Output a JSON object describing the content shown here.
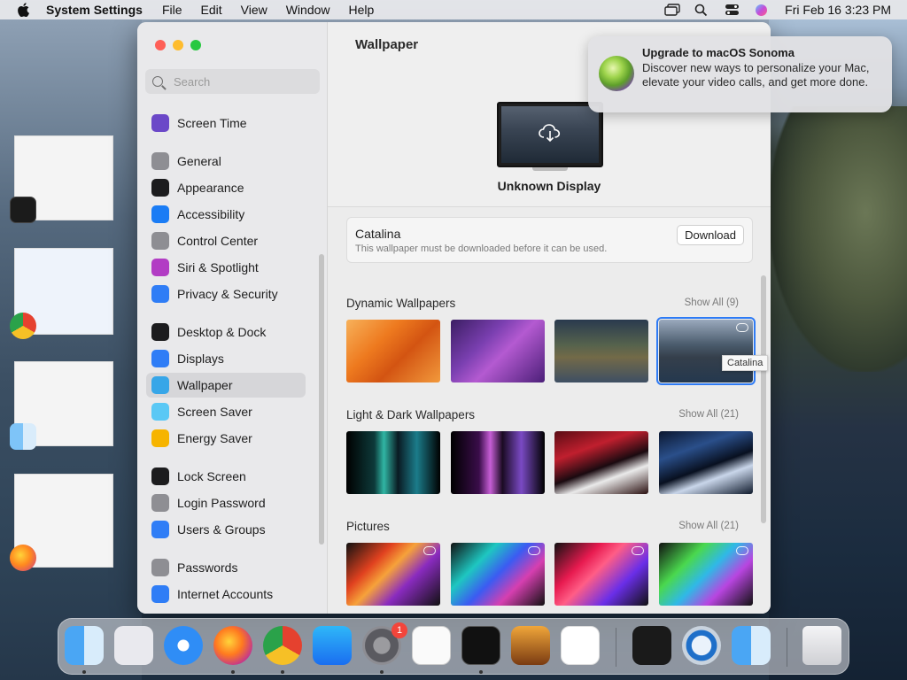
{
  "menubar": {
    "app_name": "System Settings",
    "items": [
      "File",
      "Edit",
      "View",
      "Window",
      "Help"
    ],
    "datetime": "Fri Feb 16  3:23 PM"
  },
  "window": {
    "search_placeholder": "Search",
    "sidebar": [
      {
        "label": "Screen Time",
        "icon": "hourglass-icon",
        "color": "#6b48c8"
      },
      {
        "label": "General",
        "icon": "gear-icon",
        "color": "#8e8e93"
      },
      {
        "label": "Appearance",
        "icon": "appearance-icon",
        "color": "#1c1c1e"
      },
      {
        "label": "Accessibility",
        "icon": "accessibility-icon",
        "color": "#1a7cf5"
      },
      {
        "label": "Control Center",
        "icon": "control-center-icon",
        "color": "#8e8e93"
      },
      {
        "label": "Siri & Spotlight",
        "icon": "siri-icon",
        "color": "#b23cc4"
      },
      {
        "label": "Privacy & Security",
        "icon": "hand-icon",
        "color": "#2f7df6"
      },
      {
        "label": "Desktop & Dock",
        "icon": "desktop-icon",
        "color": "#1c1c1e"
      },
      {
        "label": "Displays",
        "icon": "sun-icon",
        "color": "#2f7df6"
      },
      {
        "label": "Wallpaper",
        "icon": "flower-icon",
        "color": "#37a6e8",
        "active": true
      },
      {
        "label": "Screen Saver",
        "icon": "screen-saver-icon",
        "color": "#5ac8f5"
      },
      {
        "label": "Energy Saver",
        "icon": "battery-icon",
        "color": "#f6b400"
      },
      {
        "label": "Lock Screen",
        "icon": "lock-icon",
        "color": "#1c1c1e"
      },
      {
        "label": "Login Password",
        "icon": "lock-icon",
        "color": "#8e8e93"
      },
      {
        "label": "Users & Groups",
        "icon": "users-icon",
        "color": "#2f7df6"
      },
      {
        "label": "Passwords",
        "icon": "key-icon",
        "color": "#8e8e93"
      },
      {
        "label": "Internet Accounts",
        "icon": "at-icon",
        "color": "#2f7df6"
      }
    ],
    "title": "Wallpaper",
    "display_name": "Unknown Display",
    "current": {
      "name": "Catalina",
      "description": "This wallpaper must be downloaded before it can be used.",
      "download_label": "Download"
    },
    "sections": [
      {
        "title": "Dynamic Wallpapers",
        "show_all": "Show All (9)"
      },
      {
        "title": "Light & Dark Wallpapers",
        "show_all": "Show All (21)"
      },
      {
        "title": "Pictures",
        "show_all": "Show All (21)"
      }
    ],
    "tooltip": "Catalina"
  },
  "notification": {
    "title": "Upgrade to macOS Sonoma",
    "body": "Discover new ways to personalize your Mac, elevate your video calls, and get more done."
  },
  "dock": {
    "apps": [
      "Finder",
      "Launchpad",
      "Safari",
      "Firefox",
      "Chrome",
      "App Store",
      "System Settings",
      "TextEdit",
      "Terminal",
      "GarageBand",
      "Visual Studio Code",
      "Voice Memos",
      "QuickTime",
      "Finder",
      "Trash"
    ],
    "settings_badge": "1"
  }
}
